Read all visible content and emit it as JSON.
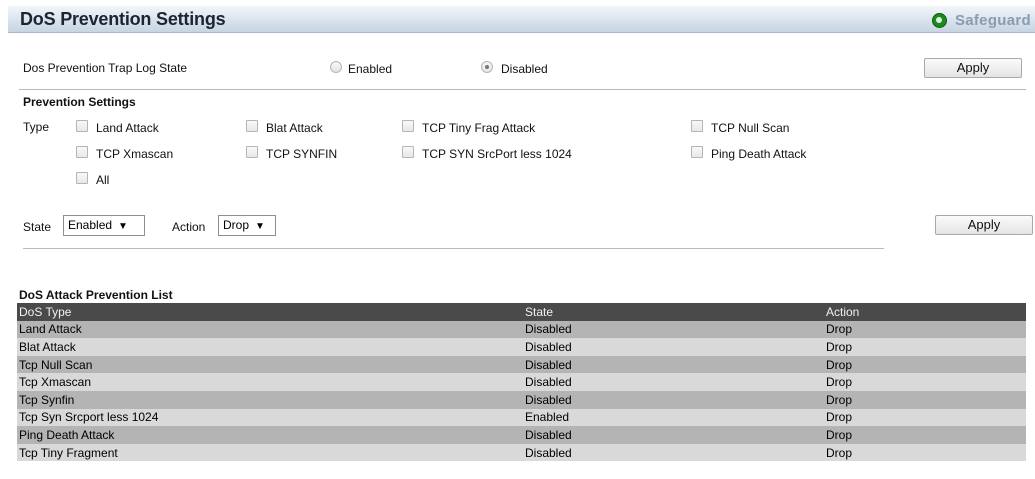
{
  "header": {
    "title": "DoS Prevention Settings",
    "safeguard_label": "Safeguard",
    "safeguard_icon": "safeguard-status-icon"
  },
  "trap_log": {
    "label": "Dos Prevention Trap Log State",
    "options": [
      "Enabled",
      "Disabled"
    ],
    "selected": "Disabled",
    "apply_label": "Apply"
  },
  "prevention": {
    "heading": "Prevention Settings",
    "type_label": "Type",
    "types": [
      {
        "label": "Land Attack",
        "checked": false
      },
      {
        "label": "Blat Attack",
        "checked": false
      },
      {
        "label": "TCP Tiny Frag Attack",
        "checked": false
      },
      {
        "label": "TCP Null Scan",
        "checked": false
      },
      {
        "label": "TCP Xmascan",
        "checked": false
      },
      {
        "label": "TCP SYNFIN",
        "checked": false
      },
      {
        "label": "TCP SYN SrcPort less 1024",
        "checked": false
      },
      {
        "label": "Ping Death Attack",
        "checked": false
      },
      {
        "label": "All",
        "checked": false
      }
    ],
    "state_label": "State",
    "state_value": "Enabled",
    "action_label": "Action",
    "action_value": "Drop",
    "apply_label": "Apply"
  },
  "list": {
    "heading": "DoS Attack Prevention List",
    "columns": [
      "DoS Type",
      "State",
      "Action"
    ],
    "rows": [
      [
        "Land Attack",
        "Disabled",
        "Drop"
      ],
      [
        "Blat Attack",
        "Disabled",
        "Drop"
      ],
      [
        "Tcp Null Scan",
        "Disabled",
        "Drop"
      ],
      [
        "Tcp Xmascan",
        "Disabled",
        "Drop"
      ],
      [
        "Tcp Synfin",
        "Disabled",
        "Drop"
      ],
      [
        "Tcp Syn Srcport less 1024",
        "Enabled",
        "Drop"
      ],
      [
        "Ping Death Attack",
        "Disabled",
        "Drop"
      ],
      [
        "Tcp Tiny Fragment",
        "Disabled",
        "Drop"
      ]
    ]
  }
}
